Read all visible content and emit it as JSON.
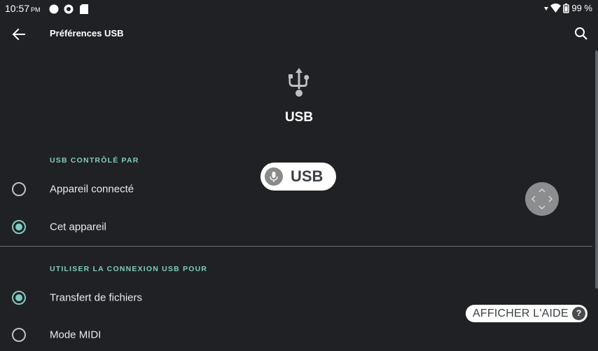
{
  "status_bar": {
    "time": "10:57",
    "ampm": "PM",
    "battery": "99 %"
  },
  "app_bar": {
    "title": "Préférences USB"
  },
  "header": {
    "title": "USB"
  },
  "section_controlled_by": {
    "label": "USB CONTRÔLÉ PAR",
    "options": [
      {
        "label": "Appareil connecté",
        "selected": false
      },
      {
        "label": "Cet appareil",
        "selected": true
      }
    ]
  },
  "section_usage": {
    "label": "UTILISER LA CONNEXION USB POUR",
    "options": [
      {
        "label": "Transfert de fichiers",
        "selected": true
      },
      {
        "label": "Mode MIDI",
        "selected": false
      }
    ]
  },
  "voice_chip": {
    "text": "USB"
  },
  "help_chip": {
    "text": "AFFICHER L'AIDE",
    "icon": "?"
  },
  "colors": {
    "background": "#202124",
    "accent": "#80cbc4"
  }
}
